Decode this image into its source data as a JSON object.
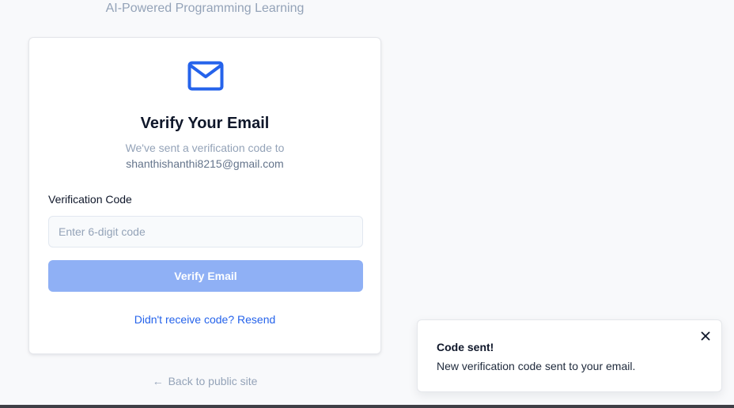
{
  "header": {
    "tagline": "AI-Powered Programming Learning"
  },
  "card": {
    "icon": "mail-icon",
    "title": "Verify Your Email",
    "subtitle": "We've sent a verification code to",
    "email": "shanthishanthi8215@gmail.com",
    "field_label": "Verification Code",
    "code_input": {
      "value": "",
      "placeholder": "Enter 6-digit code"
    },
    "verify_button": "Verify Email",
    "resend_link": "Didn't receive code? Resend"
  },
  "back_link": {
    "icon": "arrow-left-icon",
    "label": "Back to public site"
  },
  "toast": {
    "title": "Code sent!",
    "message": "New verification code sent to your email.",
    "close_icon": "close-icon"
  },
  "colors": {
    "accent": "#2563eb",
    "button_disabled": "#8fb0f5",
    "muted_text": "#94a3b8",
    "background": "#f8f9fb"
  }
}
